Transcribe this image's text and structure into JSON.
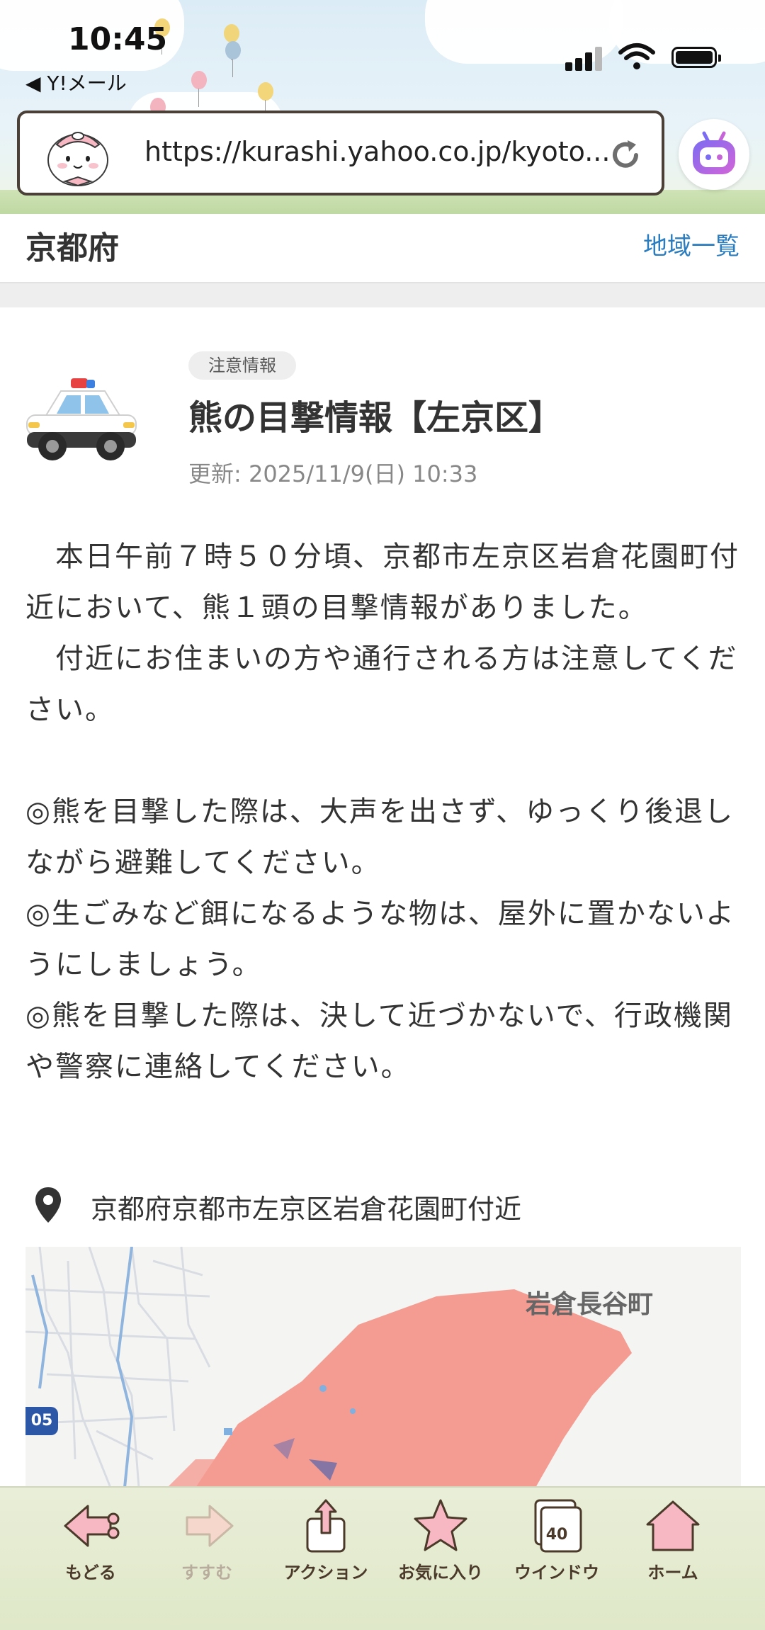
{
  "status_bar": {
    "time": "10:45",
    "back_app": "◀ Y!メール"
  },
  "browser": {
    "url": "https://kurashi.yahoo.co.jp/kyoto...",
    "reload_icon": "reload-icon",
    "assistant_icon": "ai-assistant-icon"
  },
  "region": {
    "name": "京都府",
    "list_link": "地域一覧"
  },
  "article": {
    "badge": "注意情報",
    "title": "熊の目撃情報【左京区】",
    "updated": "更新: 2025/11/9(日) 10:33",
    "body": "　本日午前７時５０分頃、京都市左京区岩倉花園町付近において、熊１頭の目撃情報がありました。\n　付近にお住まいの方や通行される方は注意してください。\n\n◎熊を目撃した際は、大声を出さず、ゆっくり後退しながら避難してください。\n◎生ごみなど餌になるような物は、屋外に置かないようにしましょう。\n◎熊を目撃した際は、決して近づかないで、行政機関や警察に連絡してください。",
    "location": "京都府京都市左京区岩倉花園町付近",
    "map": {
      "area_label": "岩倉長谷町",
      "route_number": "05",
      "highlight_color": "#f49c92"
    }
  },
  "toolbar": {
    "items": [
      {
        "label": "もどる",
        "icon": "back-arrow-icon",
        "enabled": true
      },
      {
        "label": "すすむ",
        "icon": "forward-arrow-icon",
        "enabled": false
      },
      {
        "label": "アクション",
        "icon": "share-icon",
        "enabled": true
      },
      {
        "label": "お気に入り",
        "icon": "star-icon",
        "enabled": true
      },
      {
        "label": "ウインドウ",
        "icon": "windows-icon",
        "enabled": true,
        "count": "40"
      },
      {
        "label": "ホーム",
        "icon": "home-icon",
        "enabled": true
      }
    ]
  },
  "colors": {
    "accent_link": "#2a7cc0",
    "toolbar_bg": "#e4ebcf",
    "icon_pink": "#f7b8c4"
  }
}
